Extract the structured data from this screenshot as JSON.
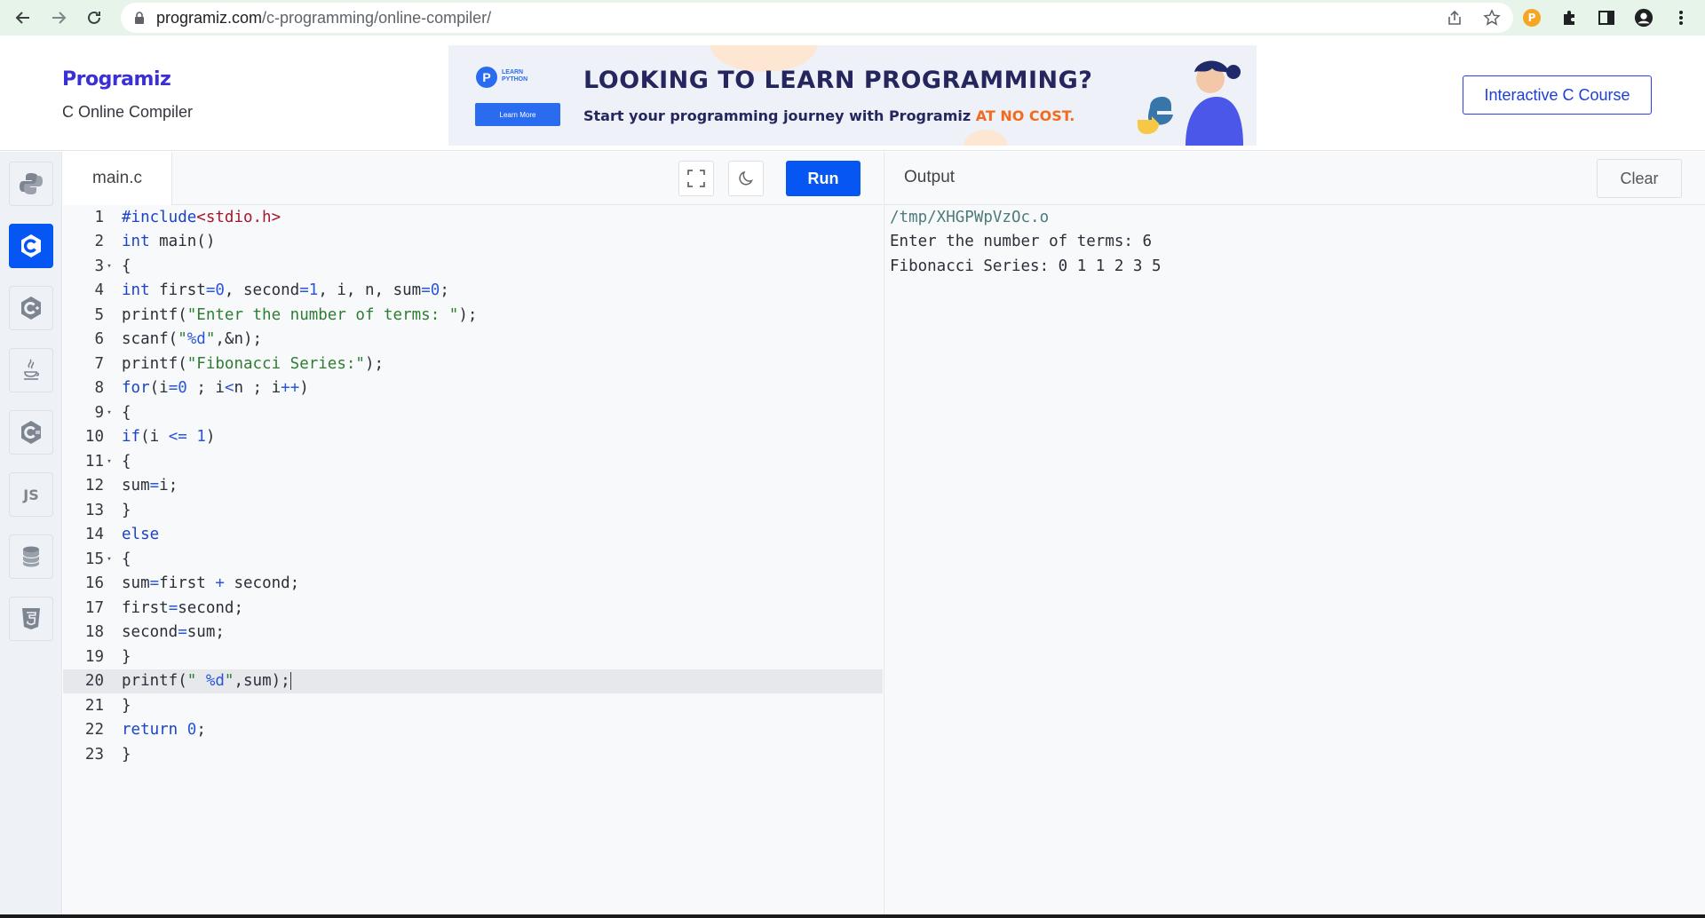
{
  "browser": {
    "url_host": "programiz.com",
    "url_path": "/c-programming/online-compiler/"
  },
  "header": {
    "logo": "Programiz",
    "subtitle": "C Online Compiler",
    "course_button": "Interactive C Course"
  },
  "banner": {
    "badge_text": "LEARN PYTHON",
    "learn_more": "Learn More",
    "headline": "LOOKING TO LEARN PROGRAMMING?",
    "tagline_prefix": "Start your programming journey with Programiz ",
    "tagline_highlight": "AT NO COST."
  },
  "sidebar": {
    "languages": [
      {
        "name": "python",
        "icon": "python-icon",
        "active": false
      },
      {
        "name": "c",
        "icon": "c-icon",
        "active": true
      },
      {
        "name": "cpp",
        "icon": "cpp-icon",
        "active": false
      },
      {
        "name": "java",
        "icon": "java-icon",
        "active": false
      },
      {
        "name": "csharp",
        "icon": "csharp-icon",
        "active": false
      },
      {
        "name": "javascript",
        "icon": "js-icon",
        "label": "JS",
        "active": false
      },
      {
        "name": "sql",
        "icon": "database-icon",
        "active": false
      },
      {
        "name": "html",
        "icon": "html5-icon",
        "active": false
      }
    ]
  },
  "editor": {
    "file_name": "main.c",
    "run_label": "Run",
    "active_line": 20,
    "lines": [
      "#include<stdio.h>",
      "int main()",
      "{",
      "int first=0, second=1, i, n, sum=0;",
      "printf(\"Enter the number of terms: \");",
      "scanf(\"%d\",&n);",
      "printf(\"Fibonacci Series:\");",
      "for(i=0 ; i<n ; i++)",
      "{",
      "if(i <= 1)",
      "{",
      "sum=i;",
      "}",
      "else",
      "{",
      "sum=first + second;",
      "first=second;",
      "second=sum;",
      "}",
      "printf(\" %d\",sum);",
      "}",
      "return 0;",
      "}"
    ]
  },
  "output": {
    "title": "Output",
    "clear_label": "Clear",
    "lines": [
      "/tmp/XHGPWpVzOc.o",
      "Enter the number of terms: 6",
      "Fibonacci Series: 0 1 1 2 3 5"
    ]
  },
  "colors": {
    "accent": "#0556f3",
    "chrome_bg": "#e6f4ea",
    "editor_bg": "#f8f9fb"
  }
}
